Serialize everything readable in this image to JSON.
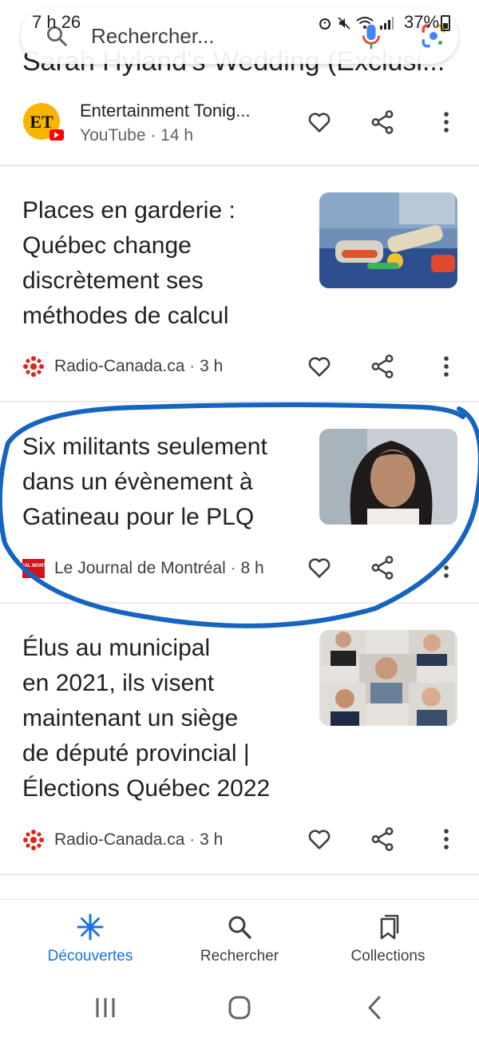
{
  "status_bar": {
    "time": "7 h 26",
    "battery": "37%"
  },
  "search": {
    "placeholder": "Rechercher..."
  },
  "top_partial_title": "Sarah Hyland's Wedding (Exclusi...",
  "cards": [
    {
      "source": "Entertainment Tonig...",
      "source_sub": "YouTube · 14 h"
    },
    {
      "title_lines": [
        "Places en garderie :",
        "Québec change",
        "discrètement ses",
        "méthodes de calcul"
      ],
      "source": "Radio-Canada.ca",
      "age": "3 h"
    },
    {
      "title_lines": [
        "Six militants seulement",
        "dans un évènement à",
        "Gatineau pour le PLQ"
      ],
      "source": "Le Journal de Montréal",
      "age": "8 h"
    },
    {
      "title_lines": [
        "Élus au municipal",
        "en 2021, ils visent",
        "maintenant un siège",
        "de député provincial |",
        "Élections Québec 2022"
      ],
      "source": "Radio-Canada.ca",
      "age": "3 h"
    }
  ],
  "bottom_nav": {
    "items": [
      {
        "label": "Découvertes",
        "icon": "asterisk-icon",
        "active": true
      },
      {
        "label": "Rechercher",
        "icon": "search-icon",
        "active": false
      },
      {
        "label": "Collections",
        "icon": "collections-icon",
        "active": false
      }
    ]
  },
  "colors": {
    "accent": "#1a73e8",
    "annotation": "#1565c0",
    "radio_canada_red": "#e32219"
  },
  "logos": {
    "et": "ET",
    "journal": "JOURNAL MONTRÉAL"
  }
}
